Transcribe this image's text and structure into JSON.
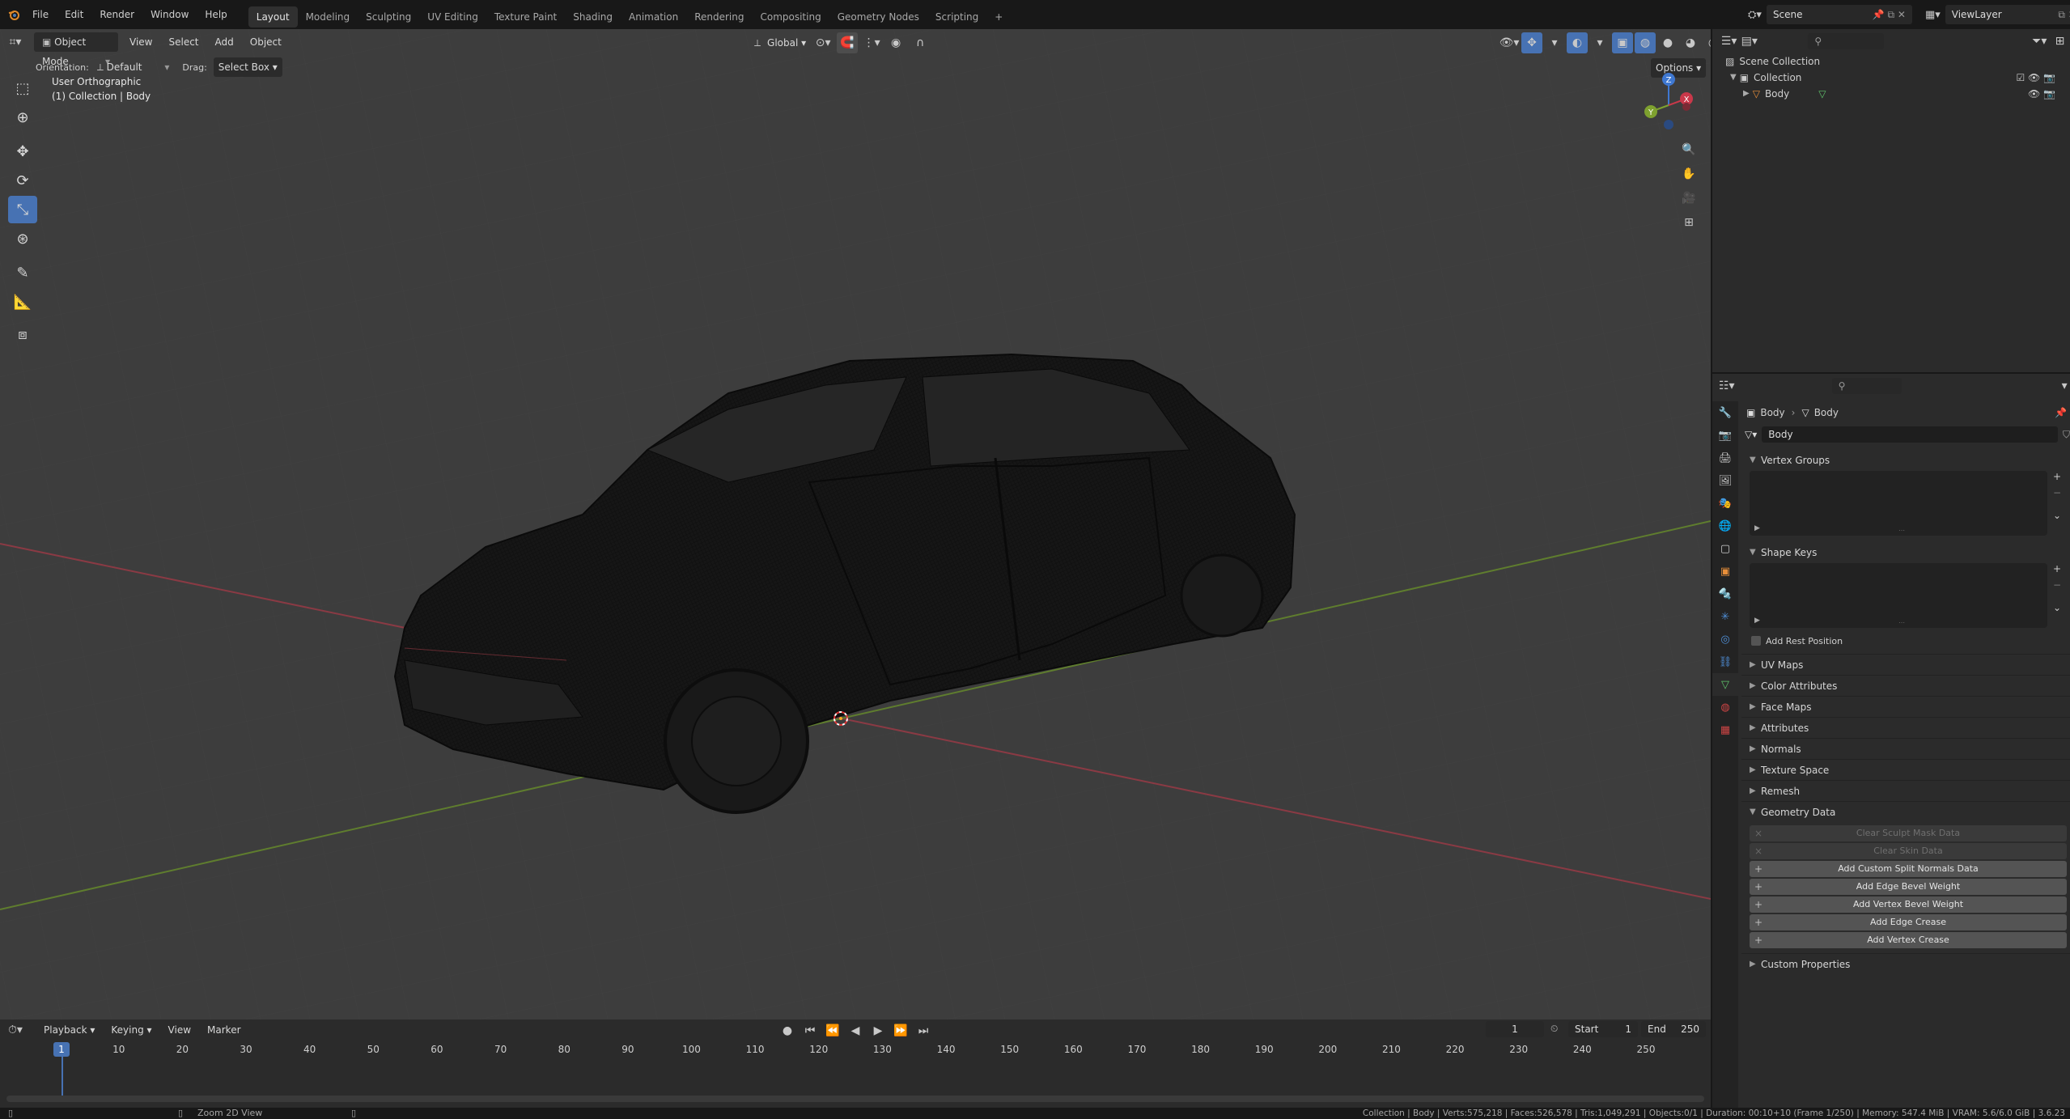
{
  "topbar": {
    "menus": [
      "File",
      "Edit",
      "Render",
      "Window",
      "Help"
    ],
    "workspaces": [
      "Layout",
      "Modeling",
      "Sculpting",
      "UV Editing",
      "Texture Paint",
      "Shading",
      "Animation",
      "Rendering",
      "Compositing",
      "Geometry Nodes",
      "Scripting"
    ],
    "active_workspace": "Layout",
    "add_tab": "+",
    "scene": "Scene",
    "view_layer": "ViewLayer"
  },
  "viewport": {
    "mode": "Object Mode",
    "menus": [
      "View",
      "Select",
      "Add",
      "Object"
    ],
    "transform_orientation": "Global",
    "orientation_label": "Orientation:",
    "orientation_value": "Default",
    "drag_label": "Drag:",
    "drag_value": "Select Box",
    "options": "Options",
    "view_name": "User Orthographic",
    "collection_info": "(1) Collection | Body",
    "gizmo_labels": {
      "z": "Z",
      "y": "Y",
      "x": "X"
    }
  },
  "tools": [
    {
      "name": "select-box-tool",
      "icon": "select-box-icon"
    },
    {
      "name": "cursor-tool",
      "icon": "cursor-icon"
    },
    {
      "name": "move-tool",
      "icon": "move-icon"
    },
    {
      "name": "rotate-tool",
      "icon": "rotate-icon"
    },
    {
      "name": "scale-tool",
      "icon": "scale-icon",
      "active": true
    },
    {
      "name": "transform-tool",
      "icon": "transform-icon"
    },
    {
      "name": "annotate-tool",
      "icon": "annotate-icon"
    },
    {
      "name": "measure-tool",
      "icon": "measure-icon"
    },
    {
      "name": "add-cube-tool",
      "icon": "add-cube-icon"
    }
  ],
  "outliner": {
    "root": "Scene Collection",
    "collection": "Collection",
    "object": "Body"
  },
  "properties": {
    "breadcrumb_object": "Body",
    "breadcrumb_data": "Body",
    "mesh_name": "Body",
    "sections": {
      "vertex_groups": "Vertex Groups",
      "shape_keys": "Shape Keys",
      "add_rest_position": "Add Rest Position",
      "uv_maps": "UV Maps",
      "color_attributes": "Color Attributes",
      "face_maps": "Face Maps",
      "attributes": "Attributes",
      "normals": "Normals",
      "texture_space": "Texture Space",
      "remesh": "Remesh",
      "geometry_data": "Geometry Data",
      "custom_properties": "Custom Properties"
    },
    "geometry_buttons": [
      {
        "label": "Clear Sculpt Mask Data",
        "disabled": true,
        "prefix": "×"
      },
      {
        "label": "Clear Skin Data",
        "disabled": true,
        "prefix": "×"
      },
      {
        "label": "Add Custom Split Normals Data",
        "disabled": false,
        "prefix": "+"
      },
      {
        "label": "Add Edge Bevel Weight",
        "disabled": false,
        "prefix": "+"
      },
      {
        "label": "Add Vertex Bevel Weight",
        "disabled": false,
        "prefix": "+"
      },
      {
        "label": "Add Edge Crease",
        "disabled": false,
        "prefix": "+"
      },
      {
        "label": "Add Vertex Crease",
        "disabled": false,
        "prefix": "+"
      }
    ]
  },
  "timeline": {
    "menus": [
      "Playback",
      "Keying",
      "View",
      "Marker"
    ],
    "current_frame": "1",
    "start_label": "Start",
    "start": "1",
    "end_label": "End",
    "end": "250",
    "ticks": [
      "1",
      "10",
      "20",
      "30",
      "40",
      "50",
      "60",
      "70",
      "80",
      "90",
      "100",
      "110",
      "120",
      "130",
      "140",
      "150",
      "160",
      "170",
      "180",
      "190",
      "200",
      "210",
      "220",
      "230",
      "240",
      "250"
    ]
  },
  "status": {
    "left_hint": "Zoom 2D View",
    "stats": "Collection | Body | Verts:575,218 | Faces:526,578 | Tris:1,049,291 | Objects:0/1 | Duration: 00:10+10 (Frame 1/250) | Memory: 547.4 MiB | VRAM: 5.6/6.0 GiB | 3.6.23"
  },
  "colors": {
    "accent": "#4772b3",
    "x_axis": "#c9384a",
    "y_axis": "#7ea12f",
    "z_axis": "#3f78d1",
    "origin": "#f5a623"
  }
}
